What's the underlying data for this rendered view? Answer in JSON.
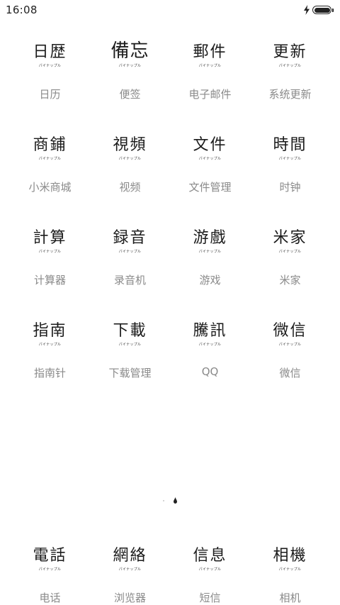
{
  "status_bar": {
    "time": "16:08"
  },
  "tiny_caption": "パイナップル",
  "apps": [
    {
      "glyph": "日歴",
      "label": "日历",
      "name": "app-calendar"
    },
    {
      "glyph": "備忘",
      "label": "便签",
      "name": "app-notes"
    },
    {
      "glyph": "郵件",
      "label": "电子邮件",
      "name": "app-email"
    },
    {
      "glyph": "更新",
      "label": "系统更新",
      "name": "app-system-update"
    },
    {
      "glyph": "商鋪",
      "label": "小米商城",
      "name": "app-mi-store"
    },
    {
      "glyph": "視頻",
      "label": "视频",
      "name": "app-video"
    },
    {
      "glyph": "文件",
      "label": "文件管理",
      "name": "app-file-manager"
    },
    {
      "glyph": "時間",
      "label": "时钟",
      "name": "app-clock"
    },
    {
      "glyph": "計算",
      "label": "计算器",
      "name": "app-calculator"
    },
    {
      "glyph": "録音",
      "label": "录音机",
      "name": "app-recorder"
    },
    {
      "glyph": "游戲",
      "label": "游戏",
      "name": "app-games"
    },
    {
      "glyph": "米家",
      "label": "米家",
      "name": "app-mijia"
    },
    {
      "glyph": "指南",
      "label": "指南针",
      "name": "app-compass"
    },
    {
      "glyph": "下載",
      "label": "下载管理",
      "name": "app-downloads"
    },
    {
      "glyph": "騰訊",
      "label": "QQ",
      "name": "app-qq"
    },
    {
      "glyph": "微信",
      "label": "微信",
      "name": "app-wechat"
    }
  ],
  "dock": [
    {
      "glyph": "電話",
      "label": "电话",
      "name": "dock-phone"
    },
    {
      "glyph": "網絡",
      "label": "浏览器",
      "name": "dock-browser"
    },
    {
      "glyph": "信息",
      "label": "短信",
      "name": "dock-messages"
    },
    {
      "glyph": "相機",
      "label": "相机",
      "name": "dock-camera"
    }
  ],
  "page_indicator": {
    "page_count": 2,
    "current_page": 2
  }
}
